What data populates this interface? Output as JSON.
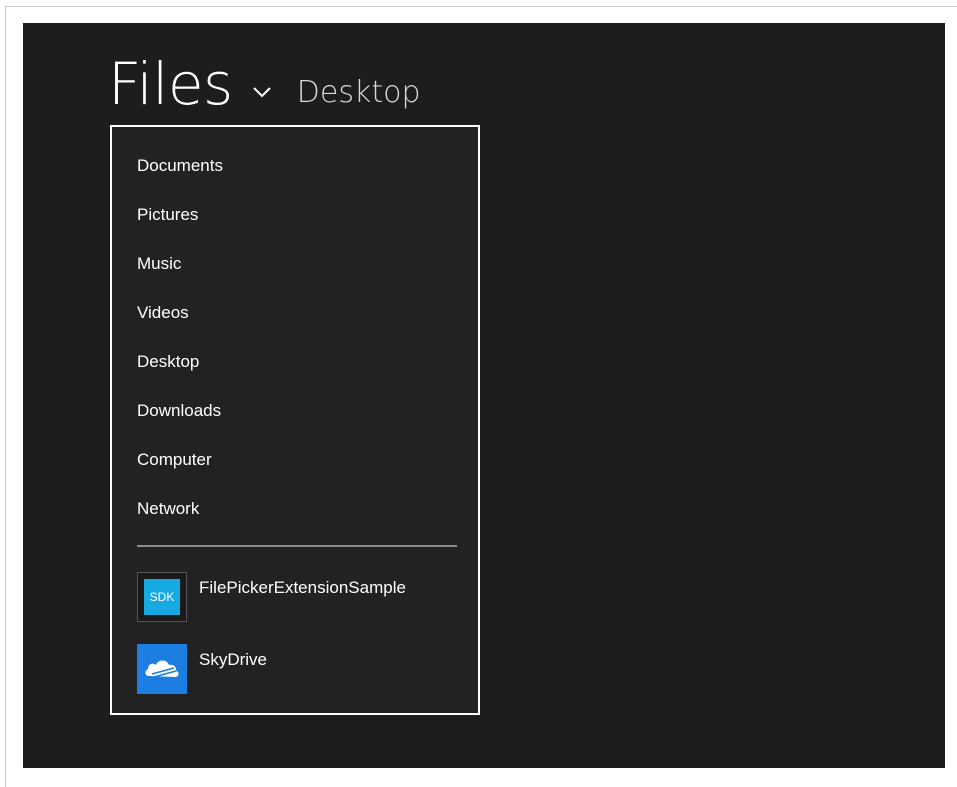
{
  "header": {
    "title": "Files",
    "current_location": "Desktop"
  },
  "locations": [
    {
      "label": "Documents"
    },
    {
      "label": "Pictures"
    },
    {
      "label": "Music"
    },
    {
      "label": "Videos"
    },
    {
      "label": "Desktop"
    },
    {
      "label": "Downloads"
    },
    {
      "label": "Computer"
    },
    {
      "label": "Network"
    }
  ],
  "apps": [
    {
      "label": "FilePickerExtensionSample",
      "tile_text": "SDK",
      "icon": "sdk-icon",
      "tile_color": "#17a9e2"
    },
    {
      "label": "SkyDrive",
      "icon": "skydrive-cloud-icon",
      "tile_color": "#1b7ee0"
    }
  ],
  "colors": {
    "background": "#1d1d1d",
    "dropdown_background": "#222222",
    "dropdown_border": "#ffffff",
    "text": "#ffffff"
  }
}
